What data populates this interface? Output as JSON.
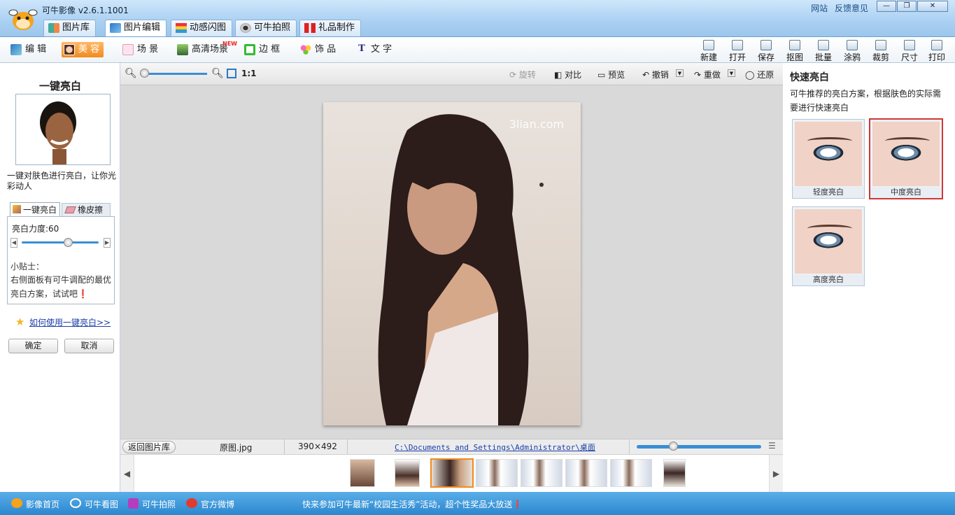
{
  "app": {
    "title": "可牛影像  v2.6.1.1001",
    "link_site": "网站",
    "link_feedback": "反馈意见"
  },
  "window_buttons": [
    "—",
    "❐",
    "✕"
  ],
  "main_tabs": [
    {
      "label": "图片库",
      "icon": "library-icon"
    },
    {
      "label": "图片编辑",
      "icon": "edit-icon"
    },
    {
      "label": "动感闪图",
      "icon": "flash-icon"
    },
    {
      "label": "可牛拍照",
      "icon": "camera-icon"
    },
    {
      "label": "礼品制作",
      "icon": "gift-icon"
    }
  ],
  "edit_tools": [
    {
      "label": "编 辑",
      "icon": "edit-icon"
    },
    {
      "label": "美 容",
      "icon": "beauty-icon"
    },
    {
      "label": "场 景",
      "icon": "scene-icon"
    },
    {
      "label": "高清场景",
      "icon": "hd-scene-icon",
      "badge": "NEW"
    },
    {
      "label": "边 框",
      "icon": "frame-icon"
    },
    {
      "label": "饰 品",
      "icon": "decor-icon"
    },
    {
      "label": "文 字",
      "icon": "text-icon"
    }
  ],
  "right_tools": [
    "新建",
    "打开",
    "保存",
    "抠图",
    "批量",
    "涂鸦",
    "裁剪",
    "尺寸",
    "打印"
  ],
  "left": {
    "title": "一键亮白",
    "description": "一键对肤色进行亮白，让你光彩动人",
    "tab_one": "一键亮白",
    "tab_two": "橡皮擦",
    "strength_label": "亮白力度:60",
    "strength_value": 60,
    "tip_title": "小贴士：",
    "tip_body": "右侧面板有可牛调配的最优亮白方案，试试吧❗",
    "howto_link": "如何使用一键亮白>>",
    "ok": "确定",
    "cancel": "取消"
  },
  "canvas_tools": {
    "zoom_ratio": "1:1",
    "rotate": "旋转",
    "compare": "对比",
    "preview": "预览",
    "undo": "撤销",
    "redo": "重做",
    "restore": "还原"
  },
  "photo": {
    "watermark": "3lian.com"
  },
  "status": {
    "back": "返回图片库",
    "filename": "原图.jpg",
    "dimensions": "390×492",
    "path": "C:\\Documents and Settings\\Administrator\\桌面"
  },
  "right": {
    "title": "快速亮白",
    "description": "可牛推荐的亮白方案，根据肤色的实际需要进行快速亮白",
    "presets": [
      {
        "label": "轻度亮白",
        "selected": false
      },
      {
        "label": "中度亮白",
        "selected": true
      },
      {
        "label": "高度亮白",
        "selected": false
      }
    ]
  },
  "bottom": {
    "links": [
      "影像首页",
      "可牛看图",
      "可牛拍照",
      "官方微博"
    ],
    "promo": "快来参加可牛最新“校园生活秀”活动，超个性奖品大放送❗"
  },
  "colors": {
    "accent": "#f28a1e",
    "bar_blue": "#3a8fd4",
    "link": "#1b3fa8"
  }
}
